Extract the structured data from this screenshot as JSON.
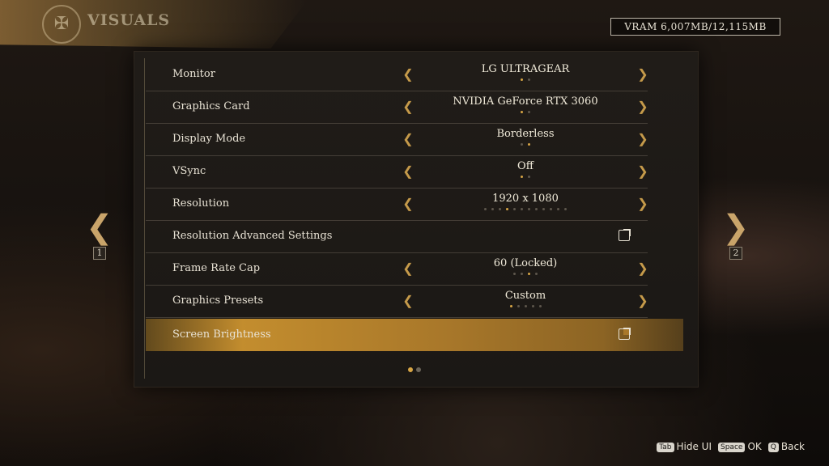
{
  "header": {
    "title": "VISUALS",
    "emblem_icon": "crest-icon"
  },
  "vram": "VRAM 6,007MB/12,115MB",
  "settings": [
    {
      "label": "Monitor",
      "value": "LG ULTRAGEAR",
      "dots": 2,
      "active": 0,
      "type": "select"
    },
    {
      "label": "Graphics Card",
      "value": "NVIDIA GeForce RTX 3060",
      "dots": 2,
      "active": 0,
      "type": "select"
    },
    {
      "label": "Display Mode",
      "value": "Borderless",
      "dots": 2,
      "active": 1,
      "type": "select"
    },
    {
      "label": "VSync",
      "value": "Off",
      "dots": 2,
      "active": 0,
      "type": "select"
    },
    {
      "label": "Resolution",
      "value": "1920 x 1080",
      "dots": 12,
      "active": 3,
      "type": "select"
    },
    {
      "label": "Resolution Advanced Settings",
      "type": "link"
    },
    {
      "label": "Frame Rate Cap",
      "value": "60 (Locked)",
      "dots": 4,
      "active": 2,
      "type": "select"
    },
    {
      "label": "Graphics Presets",
      "value": "Custom",
      "dots": 5,
      "active": 0,
      "type": "select"
    },
    {
      "label": "Screen Brightness",
      "type": "link",
      "highlighted": true
    }
  ],
  "pagination": {
    "pages": 2,
    "current": 0
  },
  "nav": {
    "left_number": "1",
    "right_number": "2"
  },
  "footer": [
    {
      "key": "Tab",
      "label": "Hide UI"
    },
    {
      "key": "Space",
      "label": "OK"
    },
    {
      "key": "Q",
      "label": "Back"
    }
  ],
  "colors": {
    "accent": "#c59a4a",
    "highlight": "#c38d2e",
    "text": "#e8e2d4"
  }
}
